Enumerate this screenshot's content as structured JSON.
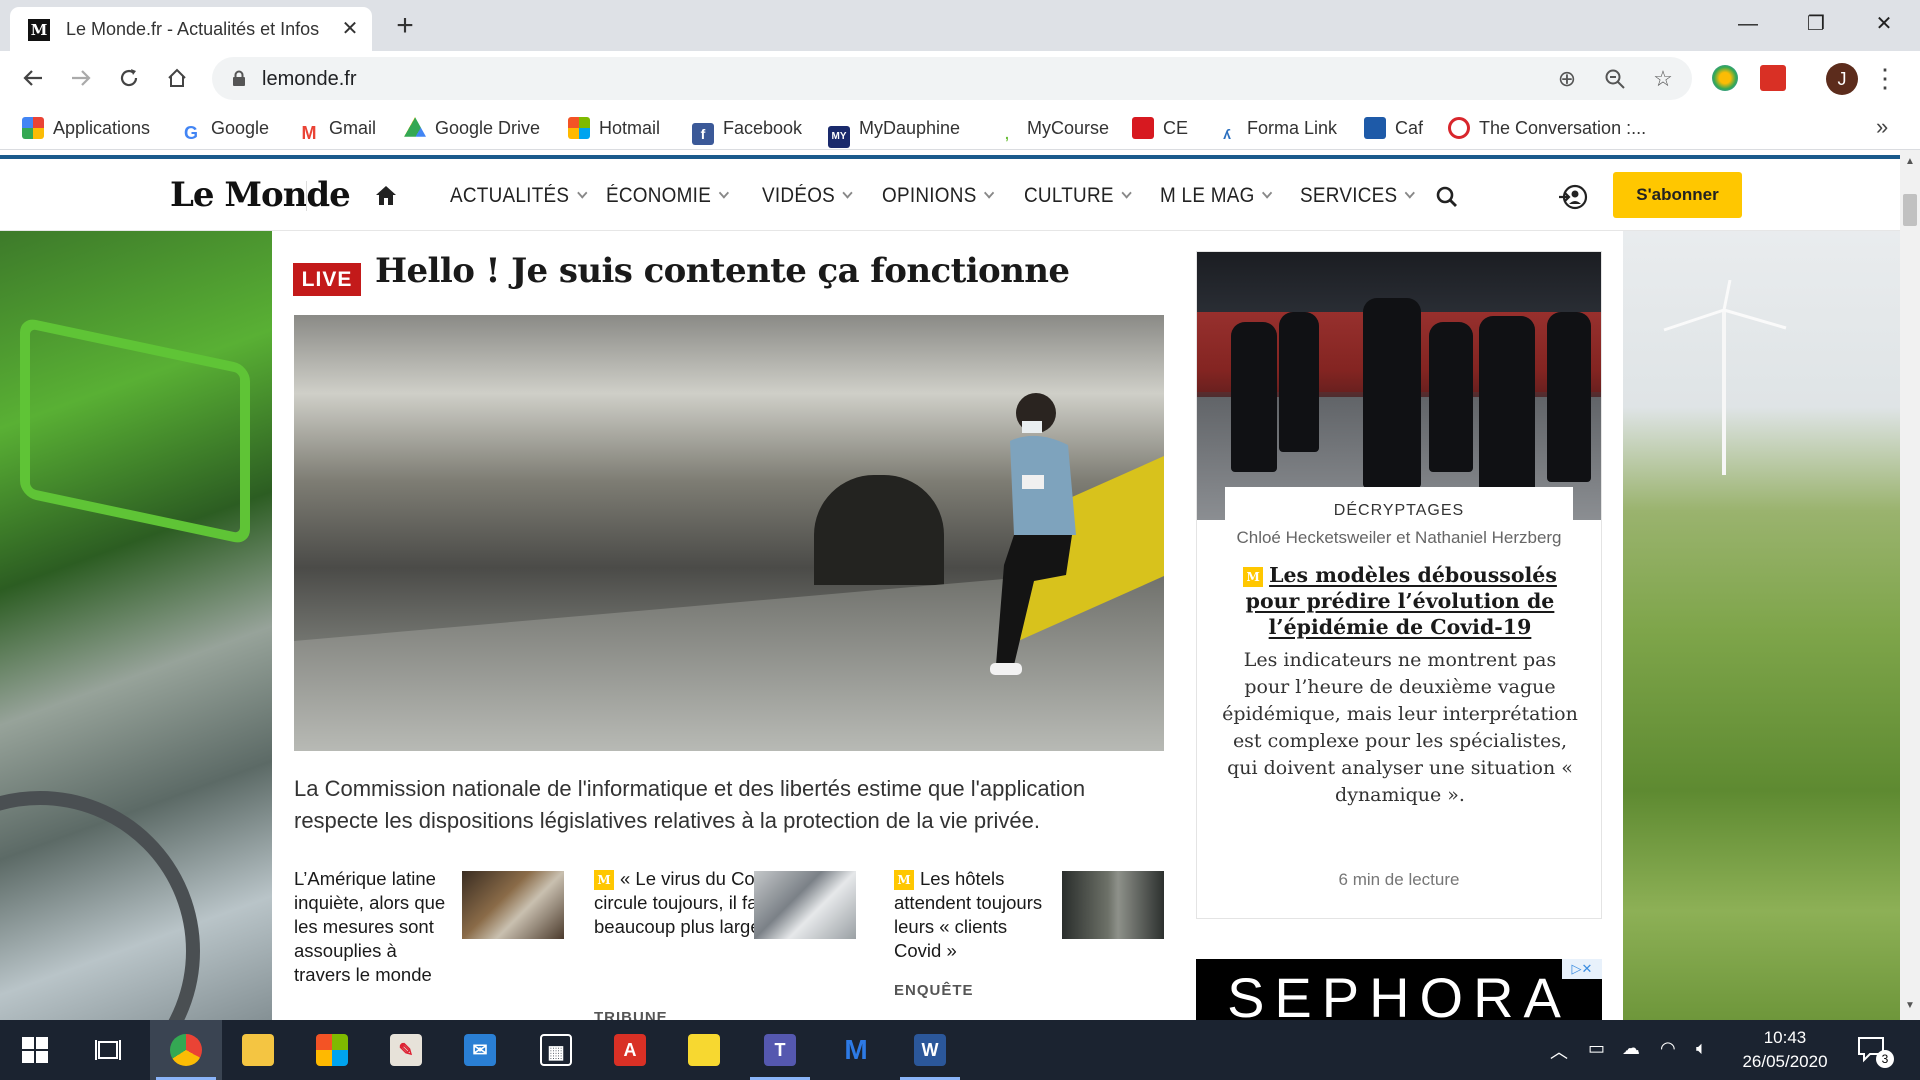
{
  "browser": {
    "tab_title": "Le Monde.fr - Actualités et Infos",
    "tab_favicon_letter": "M",
    "url": "lemonde.fr",
    "profile_initial": "J",
    "bookmarks": [
      {
        "label": "Applications",
        "icon": "apps-grid-icon",
        "color": "#ea4335"
      },
      {
        "label": "Google",
        "icon": "google-icon",
        "color": "#4285f4"
      },
      {
        "label": "Gmail",
        "icon": "gmail-icon",
        "color": "#ea4335"
      },
      {
        "label": "Google Drive",
        "icon": "google-drive-icon",
        "color": "#34a853"
      },
      {
        "label": "Hotmail",
        "icon": "microsoft-icon",
        "color": "#f35325"
      },
      {
        "label": "Facebook",
        "icon": "facebook-icon",
        "color": "#3b5998"
      },
      {
        "label": "MyDauphine",
        "icon": "mydauphine-icon",
        "color": "#1a2a6c"
      },
      {
        "label": "MyCourse",
        "icon": "mycourse-icon",
        "color": "#6bbf3a"
      },
      {
        "label": "CE",
        "icon": "ce-icon",
        "color": "#d71920"
      },
      {
        "label": "Forma Link",
        "icon": "forma-link-icon",
        "color": "#2a6fbf"
      },
      {
        "label": "Caf",
        "icon": "caf-icon",
        "color": "#1e5aa8"
      },
      {
        "label": "The Conversation :...",
        "icon": "the-conversation-icon",
        "color": "#d8262c"
      }
    ]
  },
  "site": {
    "logo": "Le Monde",
    "nav": [
      "ACTUALITÉS",
      "ÉCONOMIE",
      "VIDÉOS",
      "OPINIONS",
      "CULTURE",
      "M LE MAG",
      "SERVICES"
    ],
    "subscribe_label": "S'abonner",
    "accent": "#ffc700"
  },
  "main": {
    "live_label": "LIVE",
    "headline": "Hello ! Je suis contente ça fonctionne",
    "lead": "La Commission nationale de l'informatique et des libertés estime que l'application respecte les dispositions législatives relatives à la protection de la vie privée.",
    "subarticles": [
      {
        "title": "L’Amérique latine inquiète, alors que les mesures sont assouplies à travers le monde",
        "premium": false,
        "kicker": ""
      },
      {
        "title": "« Le virus du Covid-19 circule toujours, il faut tester beaucoup plus largement »",
        "premium": true,
        "kicker": "TRIBUNE"
      },
      {
        "title": "Les hôtels attendent toujours leurs « clients Covid »",
        "premium": true,
        "kicker": "ENQUÊTE"
      }
    ]
  },
  "card": {
    "kicker": "DÉCRYPTAGES",
    "authors": "Chloé Hecketsweiler et Nathaniel Herzberg",
    "title": "Les modèles déboussolés pour prédire l’évolution de l’épidémie de Covid-19",
    "description": "Les indicateurs ne montrent pas pour l’heure de deuxième vague épidémique, mais leur interprétation est complexe pour les spécialistes, qui doivent analyser une situation « dynamique ».",
    "read_time": "6 min de lecture"
  },
  "ad": {
    "brand": "SEPHORA"
  },
  "taskbar": {
    "time": "10:43",
    "date": "26/05/2020",
    "notification_count": "3"
  }
}
